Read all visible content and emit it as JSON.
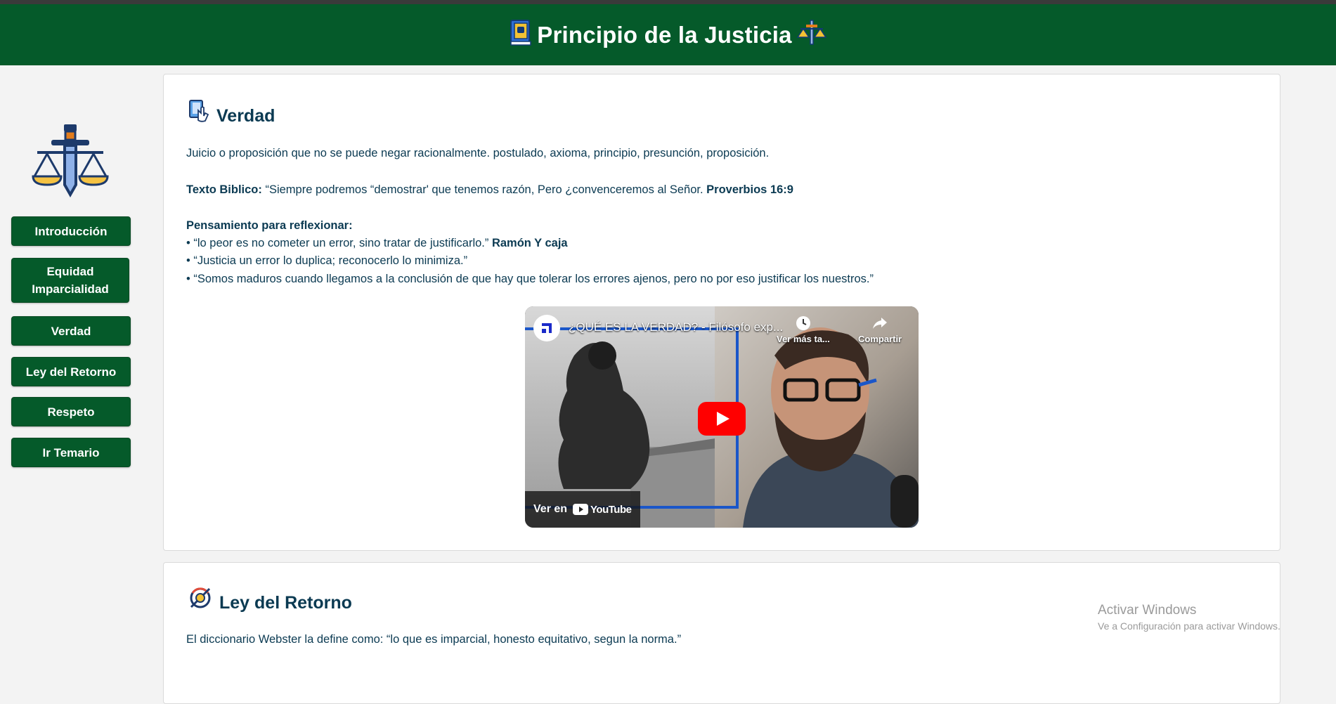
{
  "header": {
    "title": "Principio de la Justicia",
    "bg_color": "#055a2a",
    "book_icon": "book-icon",
    "scales_icon": "scales-icon"
  },
  "sidebar": {
    "logo": "sword-scales-icon",
    "items": [
      {
        "label": "Introducción"
      },
      {
        "label": "Equidad Imparcialidad"
      },
      {
        "label": "Verdad"
      },
      {
        "label": "Ley del Retorno"
      },
      {
        "label": "Respeto"
      },
      {
        "label": "Ir Temario"
      }
    ]
  },
  "verdad": {
    "heading": "Verdad",
    "definition": "Juicio o proposición que no se puede negar racionalmente. postulado, axioma, principio, presunción, proposición.",
    "biblical_label": "Texto Biblico:",
    "biblical_text": " “Siempre podremos “demostrar' que tenemos razón, Pero ¿convenceremos al Señor. ",
    "biblical_ref": "Proverbios 16:9",
    "thought_label": "Pensamiento para reflexionar:",
    "thought1": "• “lo peor es no cometer un error, sino tratar de justificarlo.” ",
    "thought1_author": "Ramón Y caja",
    "thought2": "• “Justicia un error lo duplica; reconocerlo lo minimiza.”",
    "thought3": "• “Somos maduros cuando llegamos a la conclusión de que hay que tolerar los errores ajenos, pero no por eso justificar los nuestros.”",
    "video": {
      "title": "¿QUÉ ES LA VERDAD? - Filósofo exp...",
      "watch_later": "Ver más ta...",
      "share": "Compartir",
      "watch_on": "Ver en",
      "platform": "YouTube"
    }
  },
  "ley_retorno": {
    "heading": "Ley del Retorno",
    "definition": "El diccionario Webster la define como: “lo que es imparcial, honesto equitativo, segun la norma.”"
  },
  "watermark": {
    "line1": "Activar Windows",
    "line2": "Ve a Configuración para activar Windows."
  }
}
